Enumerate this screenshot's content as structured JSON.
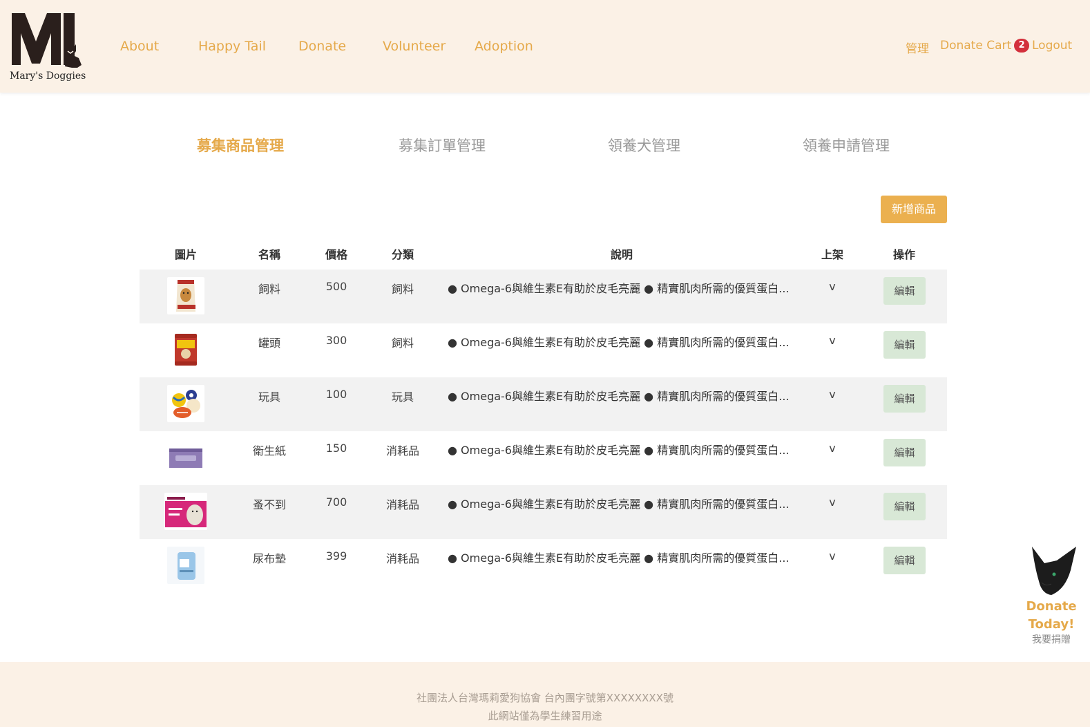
{
  "header": {
    "logo_text": "Mary's Doggies",
    "nav": [
      "About",
      "Happy Tail",
      "Donate",
      "Volunteer",
      "Adoption"
    ],
    "admin_label": "管理",
    "cart_label": "Donate Cart",
    "cart_count": "2",
    "logout_label": "Logout"
  },
  "tabs": [
    "募集商品管理",
    "募集訂單管理",
    "領養犬管理",
    "領養申請管理"
  ],
  "active_tab": 0,
  "add_button_label": "新增商品",
  "table": {
    "headers": [
      "圖片",
      "名稱",
      "價格",
      "分類",
      "說明",
      "上架",
      "操作"
    ],
    "edit_label": "編輯",
    "rows": [
      {
        "image": "dog-food-bag-image",
        "name": "飼料",
        "price": "500",
        "category": "飼料",
        "description": "● Omega-6與維生素E有助於皮毛亮麗 ● 精實肌肉所需的優質蛋白...",
        "listed": "v"
      },
      {
        "image": "dog-food-can-image",
        "name": "罐頭",
        "price": "300",
        "category": "飼料",
        "description": "● Omega-6與維生素E有助於皮毛亮麗 ● 精實肌肉所需的優質蛋白...",
        "listed": "v"
      },
      {
        "image": "dog-toy-balls-image",
        "name": "玩具",
        "price": "100",
        "category": "玩具",
        "description": "● Omega-6與維生素E有助於皮毛亮麗 ● 精實肌肉所需的優質蛋白...",
        "listed": "v"
      },
      {
        "image": "tissue-box-image",
        "name": "衛生紙",
        "price": "150",
        "category": "消耗品",
        "description": "● Omega-6與維生素E有助於皮毛亮麗 ● 精實肌肉所需的優質蛋白...",
        "listed": "v"
      },
      {
        "image": "flea-treatment-box-image",
        "name": "蚤不到",
        "price": "700",
        "category": "消耗品",
        "description": "● Omega-6與維生素E有助於皮毛亮麗 ● 精實肌肉所需的優質蛋白...",
        "listed": "v"
      },
      {
        "image": "pee-pad-pack-image",
        "name": "尿布墊",
        "price": "399",
        "category": "消耗品",
        "description": "● Omega-6與維生素E有助於皮毛亮麗 ● 精實肌肉所需的優質蛋白...",
        "listed": "v"
      }
    ]
  },
  "donate_widget": {
    "title_line1": "Donate",
    "title_line2": "Today!",
    "subtitle": "我要捐贈"
  },
  "footer": {
    "line1": "社團法人台灣瑪莉愛狗協會 台內團字號第XXXXXXXX號",
    "line2": "此網站僅為學生練習用途"
  },
  "colors": {
    "header_bg": "#fbf1e6",
    "accent": "#e5a94a",
    "badge": "#d3303c",
    "row_shade": "#f2f2f2",
    "edit_button": "#d8e8d6"
  }
}
